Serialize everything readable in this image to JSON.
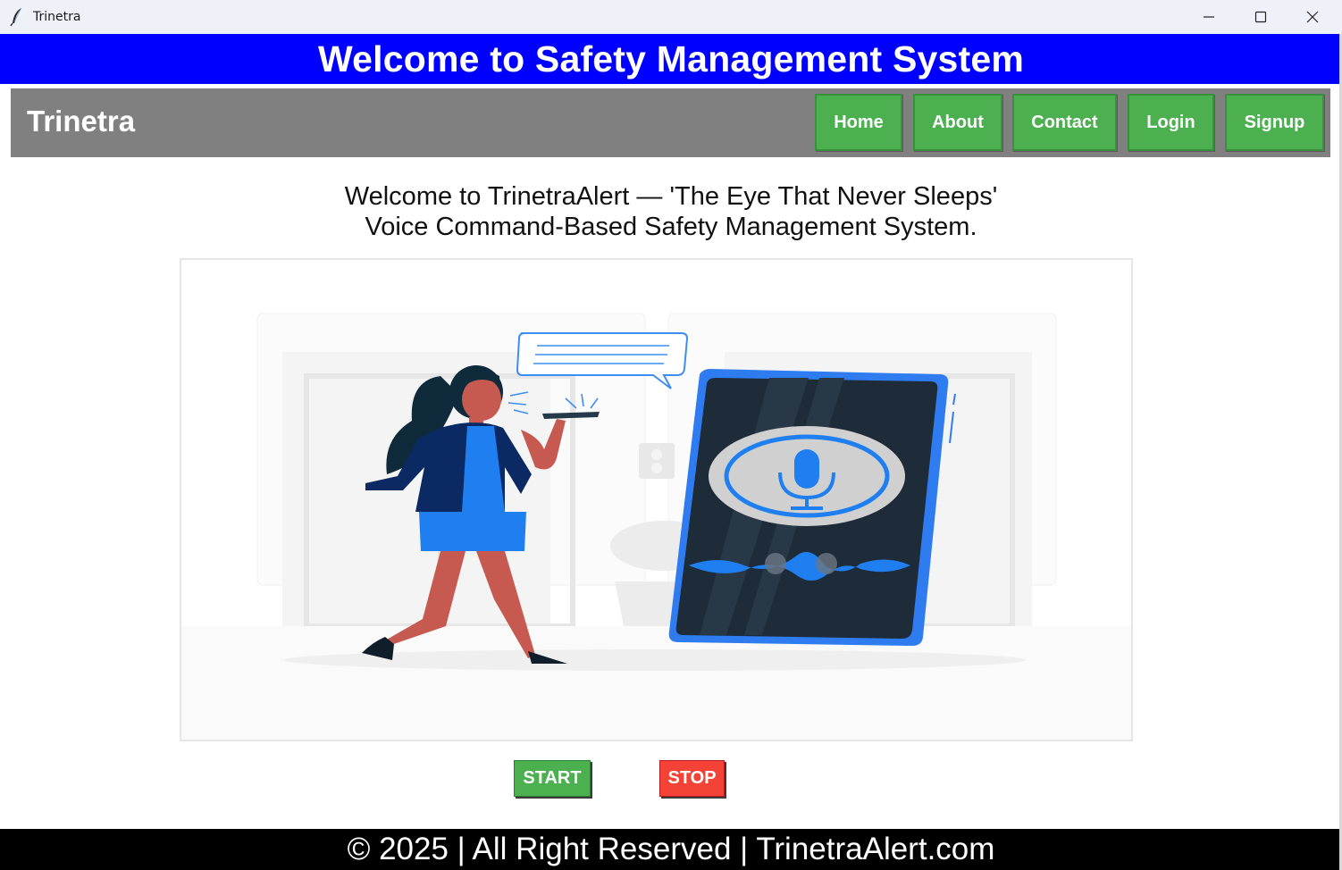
{
  "window": {
    "title": "Trinetra",
    "icon": "feather-icon",
    "controls": [
      "minimize-icon",
      "maximize-icon",
      "close-icon"
    ]
  },
  "banner": {
    "heading": "Welcome to Safety Management System",
    "color": "#0000ff"
  },
  "navbar": {
    "brand": "Trinetra",
    "color": "#808080",
    "items": [
      {
        "label": "Home"
      },
      {
        "label": "About"
      },
      {
        "label": "Contact"
      },
      {
        "label": "Login"
      },
      {
        "label": "Signup"
      }
    ],
    "button_color": "#4caf50"
  },
  "intro": {
    "line1": "Welcome to TrinetraAlert — 'The Eye That Never Sleeps'",
    "line2": "Voice Command-Based Safety Management System."
  },
  "illustration": {
    "icons": [
      "microphone-icon",
      "speech-bubble-icon",
      "sound-wave-icon"
    ]
  },
  "controls": {
    "start_label": "START",
    "stop_label": "STOP",
    "start_color": "#4caf50",
    "stop_color": "#f44336"
  },
  "footer": {
    "text": "© 2025 | All Right Reserved | TrinetraAlert.com"
  }
}
